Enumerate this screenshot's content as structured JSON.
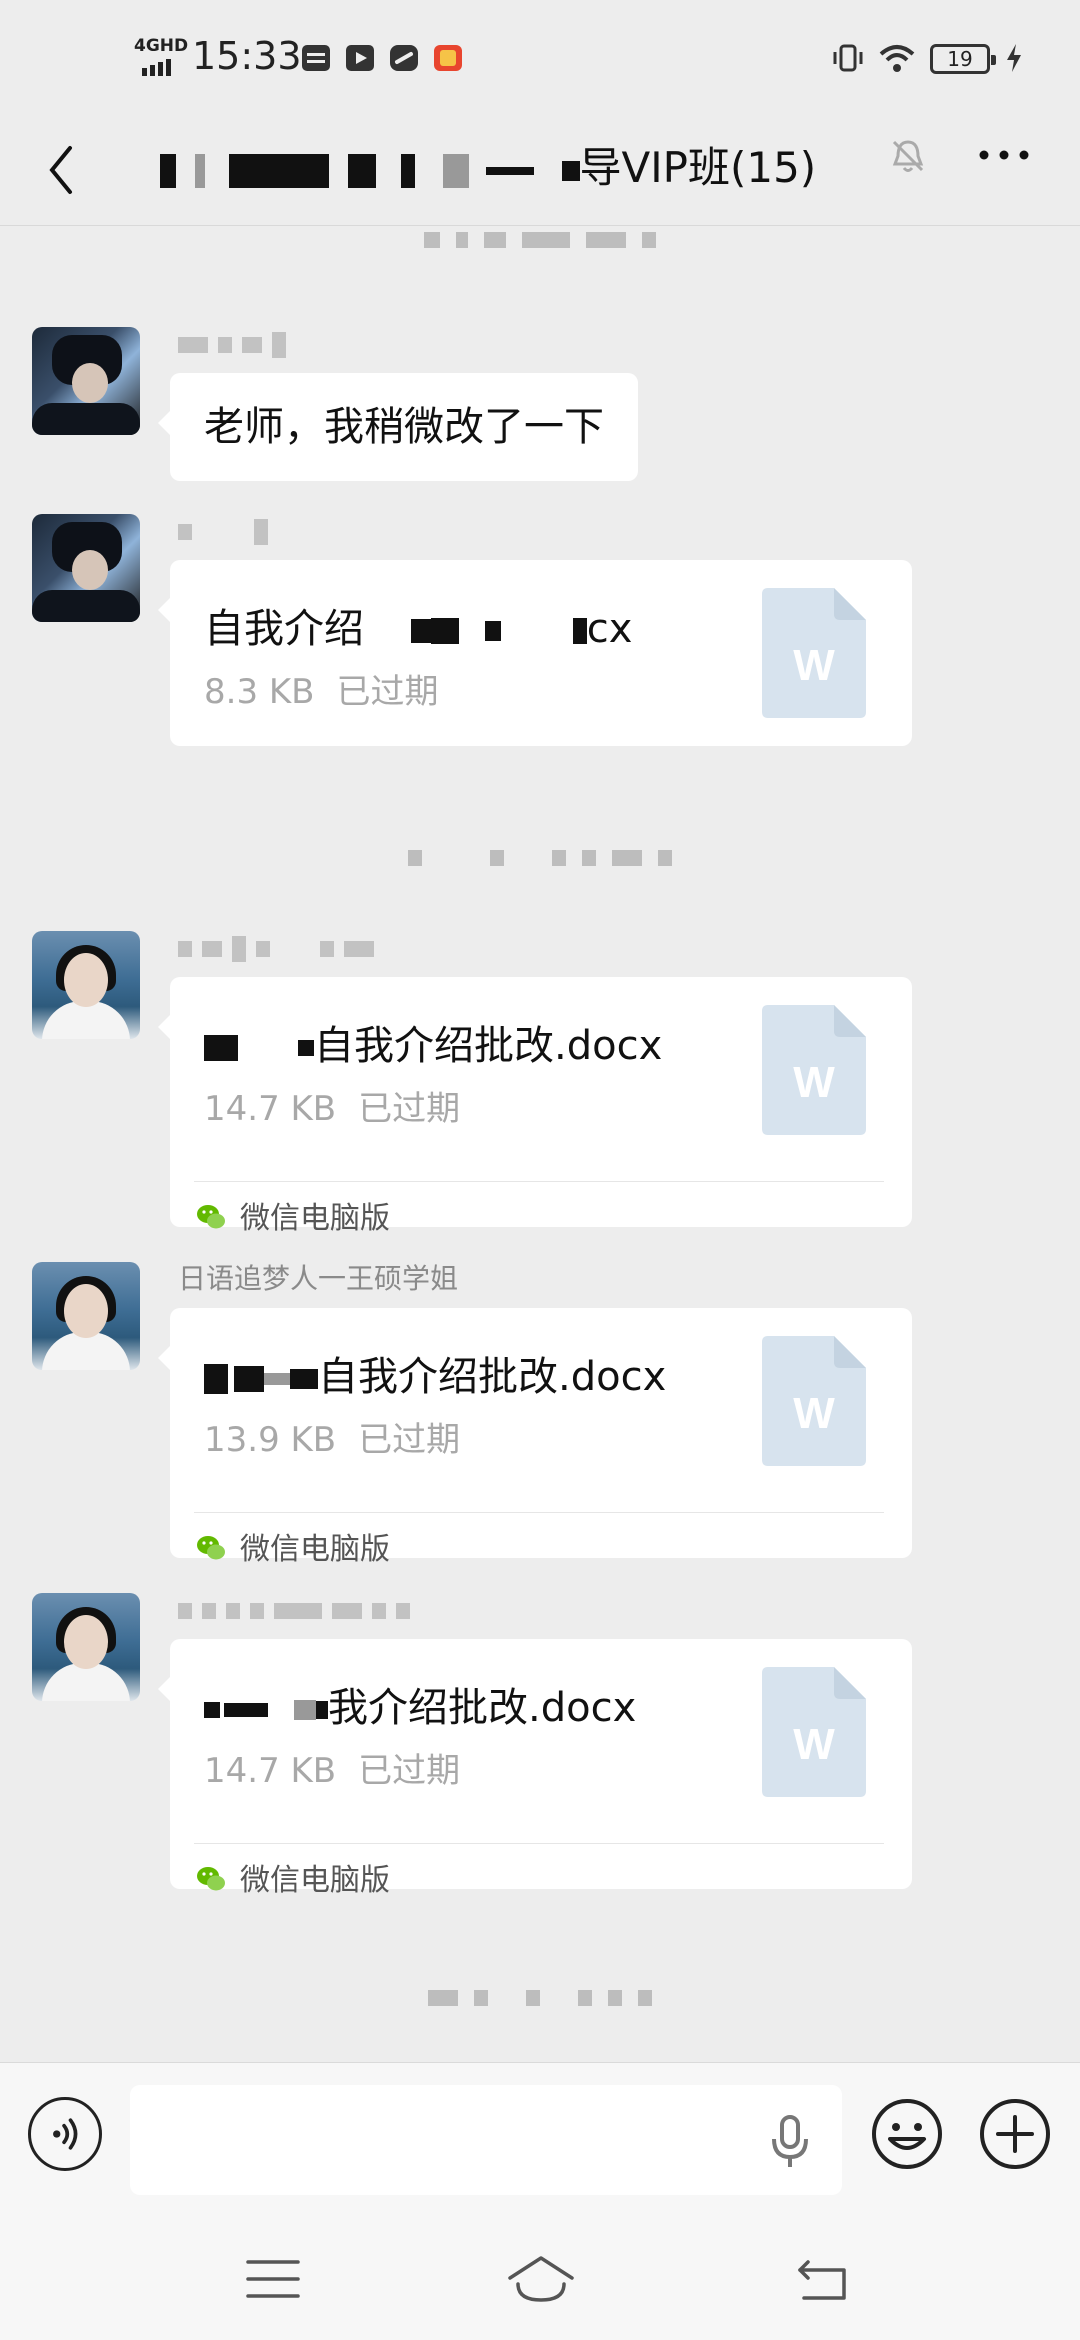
{
  "status_bar": {
    "network": "4GHD",
    "time": "15:33",
    "battery": "19"
  },
  "chat": {
    "title_suffix": "导VIP班(15)"
  },
  "messages": [
    {
      "type": "text",
      "sender": "",
      "text": "老师，我稍微改了一下"
    },
    {
      "type": "file",
      "sender": "",
      "file_name_prefix": "自我介绍",
      "file_name_suffix": "cx",
      "size": "8.3 KB",
      "status": "已过期"
    },
    {
      "type": "file",
      "sender": "",
      "file_name_suffix": "自我介绍批改.docx",
      "size": "14.7 KB",
      "status": "已过期",
      "source": "微信电脑版"
    },
    {
      "type": "file",
      "sender": "日语追梦人一王硕学姐",
      "file_name_suffix": "自我介绍批改.docx",
      "size": "13.9 KB",
      "status": "已过期",
      "source": "微信电脑版"
    },
    {
      "type": "file",
      "sender": "",
      "file_name_suffix": "我介绍批改.docx",
      "size": "14.7 KB",
      "status": "已过期",
      "source": "微信电脑版"
    }
  ],
  "colors": {
    "background": "#ededed",
    "bubble": "#ffffff",
    "file_icon": "#d7e3ee",
    "wechat_green": "#62b900"
  }
}
